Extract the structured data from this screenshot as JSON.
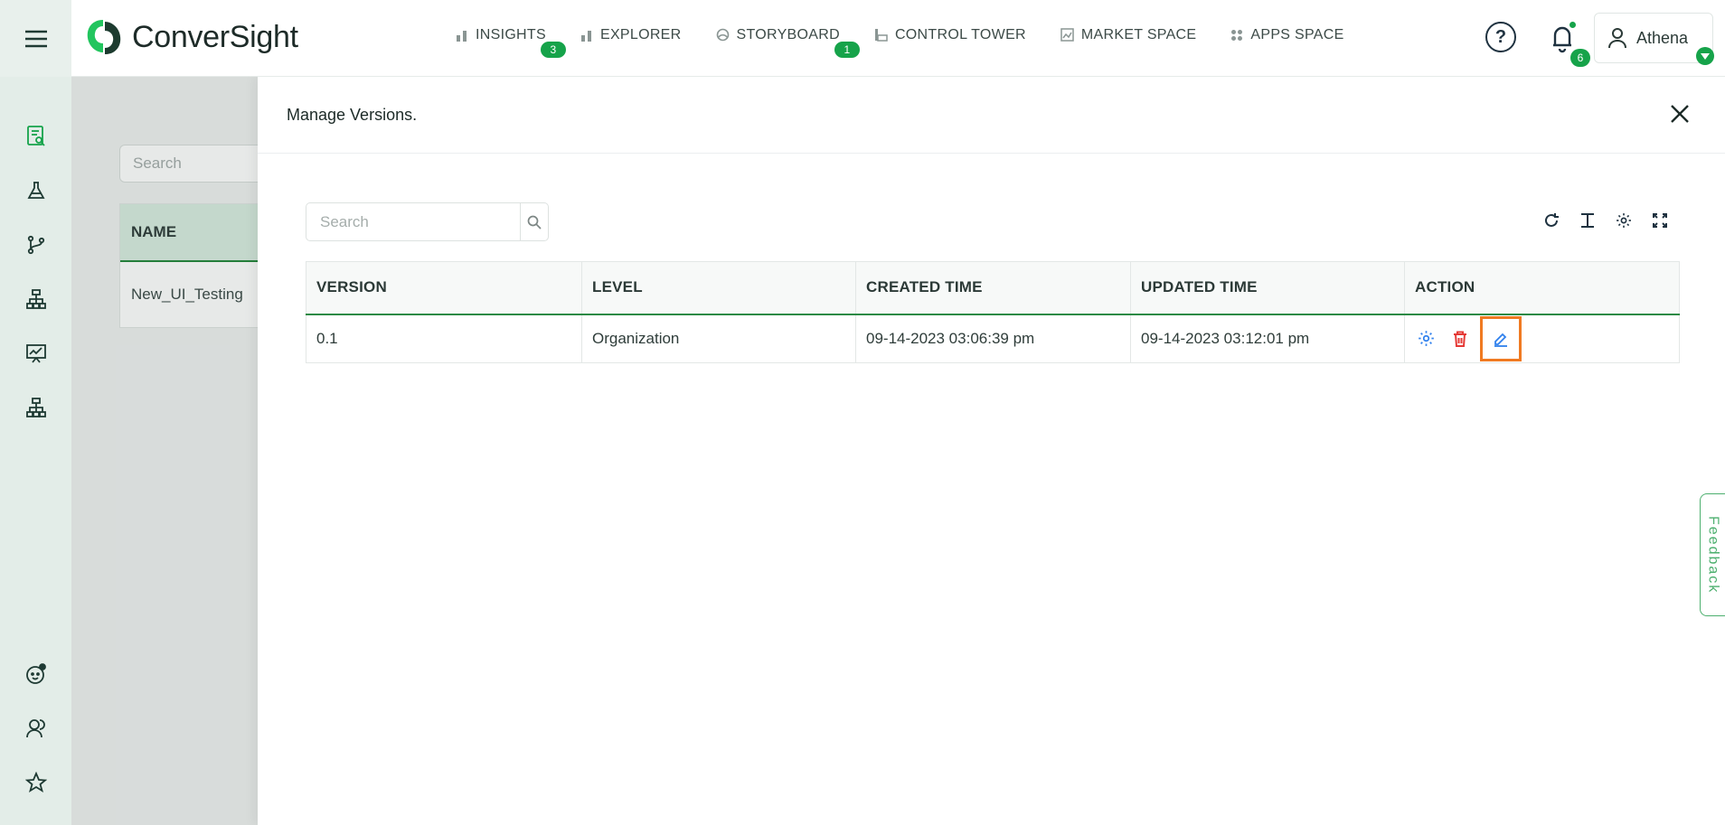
{
  "brand": {
    "name": "ConverSight"
  },
  "nav": [
    {
      "label": "INSIGHTS",
      "badge": "3"
    },
    {
      "label": "EXPLORER"
    },
    {
      "label": "STORYBOARD",
      "badge": "1"
    },
    {
      "label": "CONTROL TOWER"
    },
    {
      "label": "MARKET SPACE"
    },
    {
      "label": "APPS SPACE"
    }
  ],
  "header": {
    "notification_count": "6",
    "user_name": "Athena"
  },
  "background": {
    "search_placeholder": "Search",
    "column_name": "NAME",
    "row_name": "New_UI_Testing"
  },
  "drawer": {
    "title": "Manage Versions.",
    "search_placeholder": "Search",
    "columns": [
      "VERSION",
      "LEVEL",
      "CREATED TIME",
      "UPDATED TIME",
      "ACTION"
    ],
    "rows": [
      {
        "version": "0.1",
        "level": "Organization",
        "created": "09-14-2023 03:06:39 pm",
        "updated": "09-14-2023 03:12:01 pm"
      }
    ]
  },
  "feedback": {
    "label": "Feedback"
  },
  "colors": {
    "brand_green": "#16a34a",
    "highlight": "#f07a22",
    "action_blue": "#2f80ed",
    "delete_red": "#e53935"
  }
}
